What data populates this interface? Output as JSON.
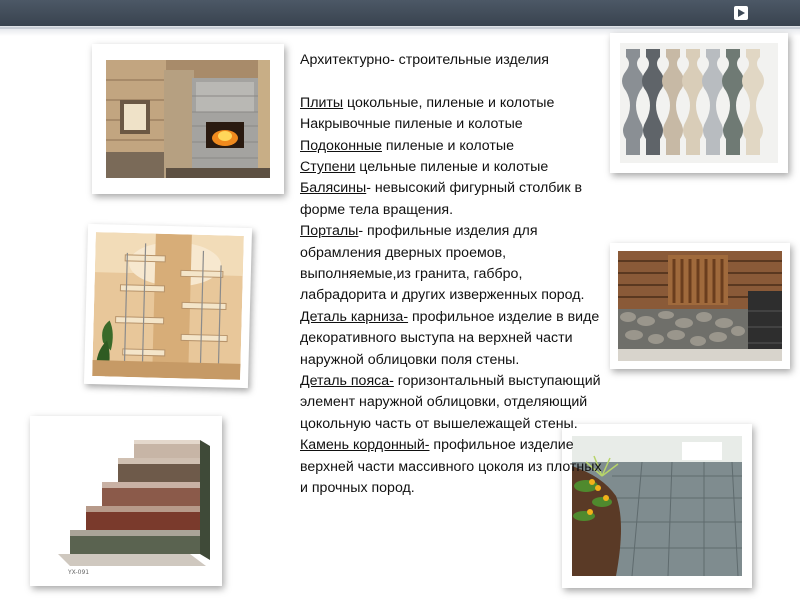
{
  "slide": {
    "heading": "Архитектурно- строительные изделия",
    "items": [
      {
        "term": "Плиты",
        "rest": " цокольные,  пиленые и колотые"
      },
      {
        "term": "",
        "rest": "Накрывочные пиленые и колотые"
      },
      {
        "term": "Подоконные",
        "rest": " пиленые и колотые"
      },
      {
        "term": "Ступени",
        "rest": " цельные пиленые и колотые"
      },
      {
        "term": "Балясины",
        "rest": "- невысокий фигурный столбик  в форме тела вращения."
      },
      {
        "term": "Порталы",
        "rest": "- профильные изделия для обрамления дверных проемов, выполняемые,из гранита, габбро, лабрадорита и других изверженных пород."
      },
      {
        "term": "Деталь карниза-",
        "rest": " профильное изделие в виде декоративного выступа на верхней части наружной облицовки поля стены."
      },
      {
        "term": "Деталь пояса-",
        "rest": " горизонтальный выступающий элемент наружной облицовки, отделяющий цокольную часть от вышележащей стены."
      },
      {
        "term": "Камень кордонный-",
        "rest": " профильное изделие верхней части массивного цоколя из плотных и прочных пород."
      }
    ],
    "images": {
      "stairs_caption": "YX-091"
    }
  }
}
